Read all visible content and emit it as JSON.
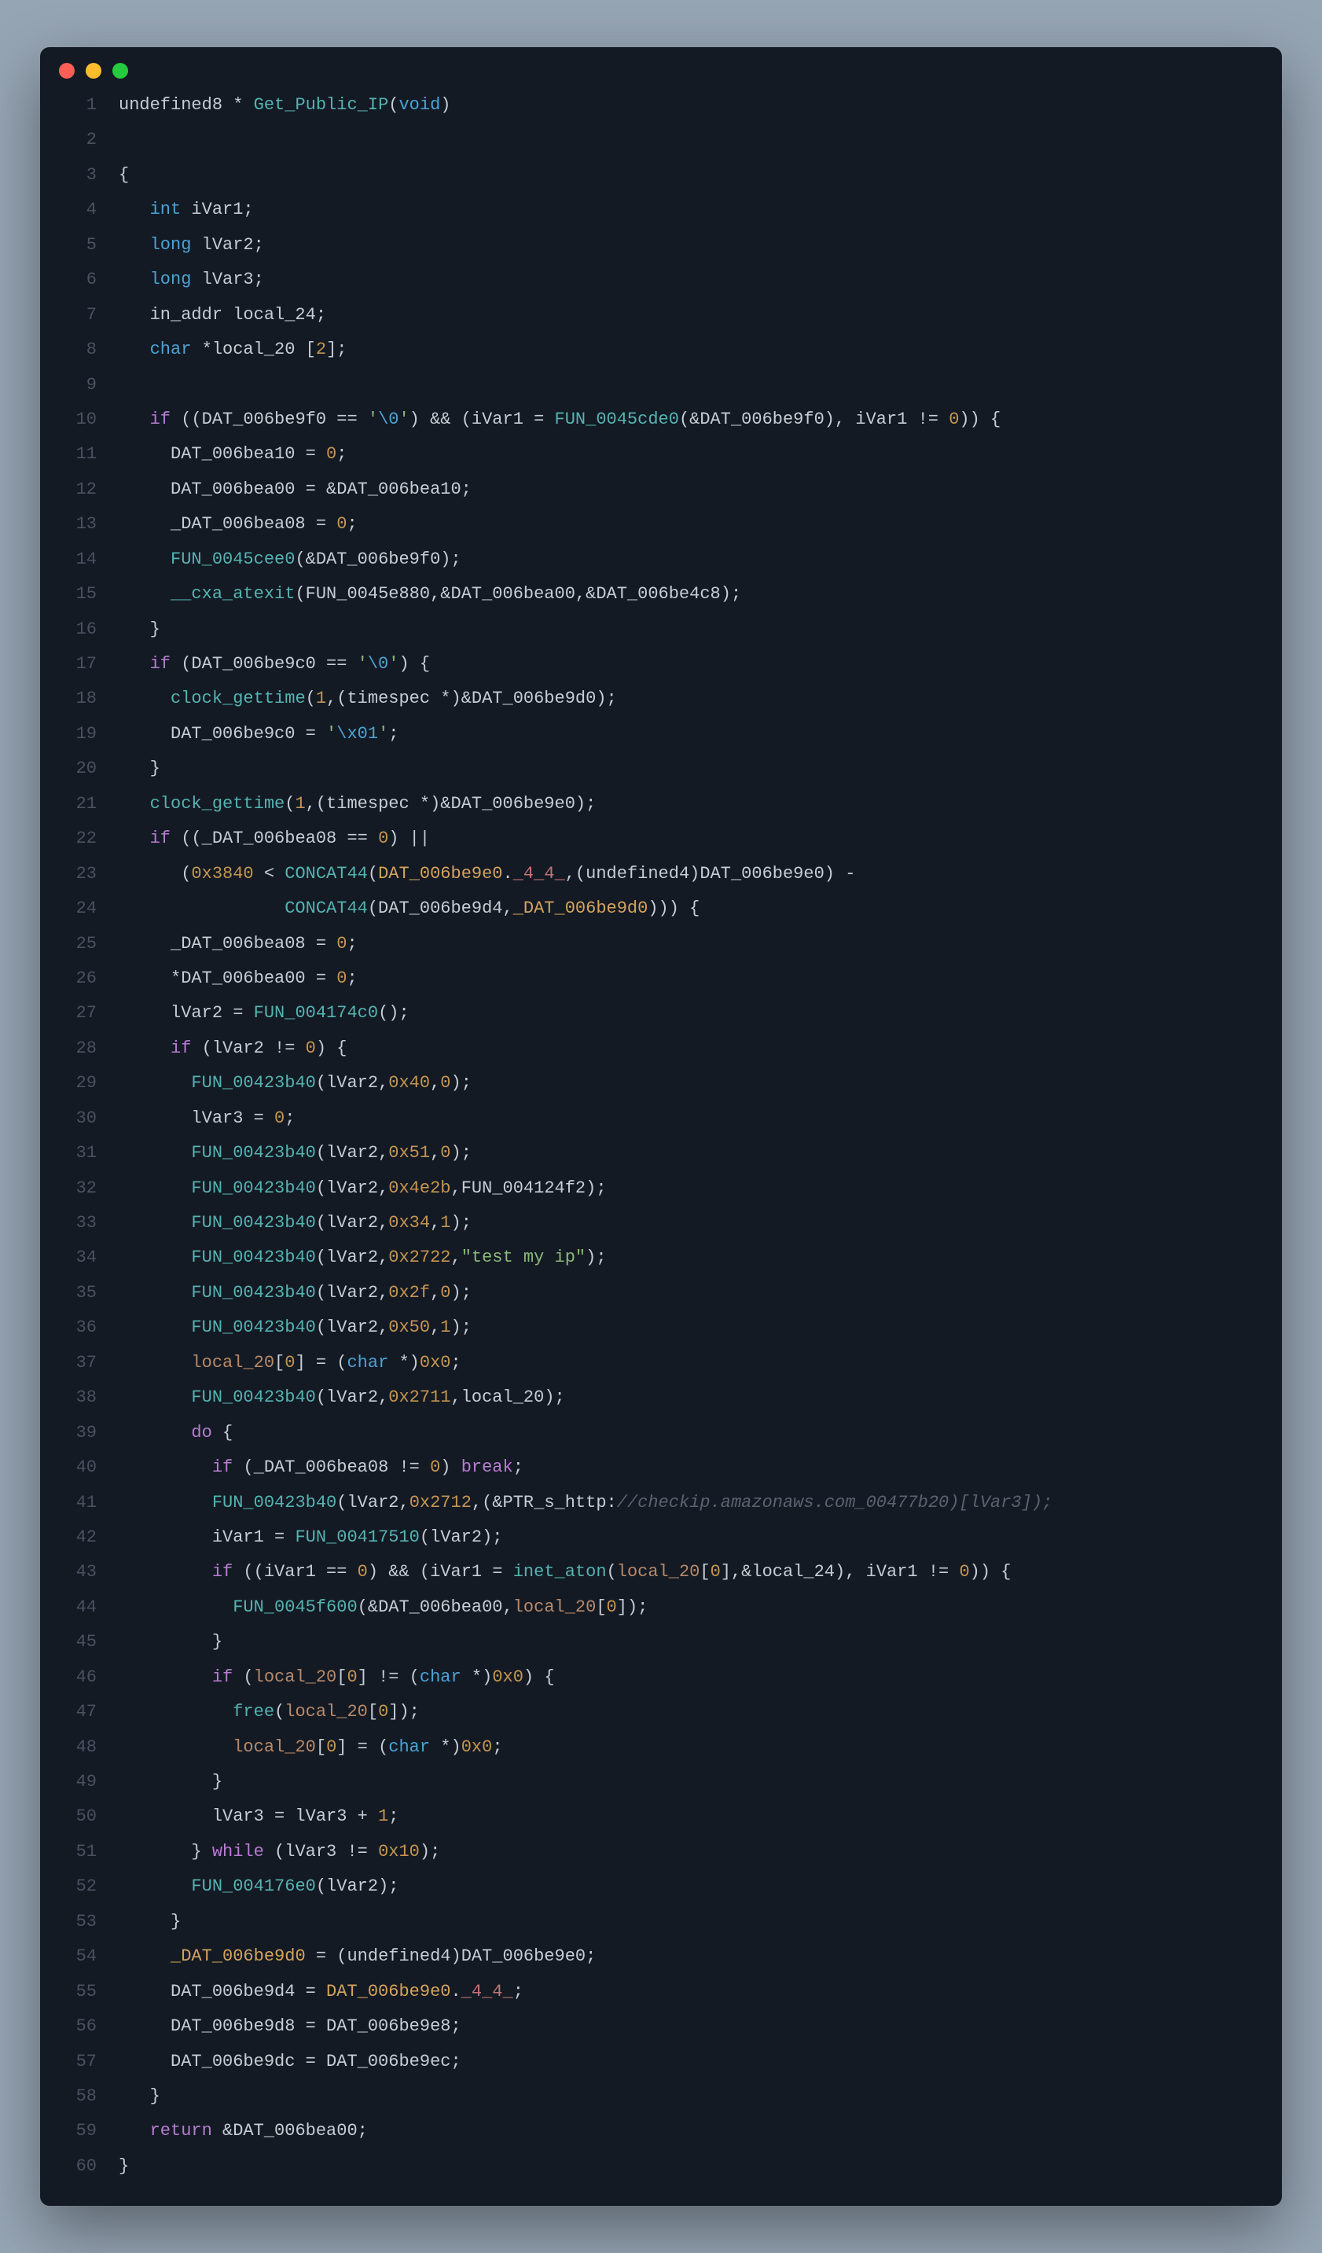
{
  "window": {
    "traffic_lights": [
      "red",
      "yellow",
      "green"
    ]
  },
  "code_lines": [
    {
      "n": 1,
      "tokens": [
        [
          "plain",
          "undefined8 * "
        ],
        [
          "fn",
          "Get_Public_IP"
        ],
        [
          "plain",
          "("
        ],
        [
          "type",
          "void"
        ],
        [
          "plain",
          ")"
        ]
      ]
    },
    {
      "n": 2,
      "tokens": []
    },
    {
      "n": 3,
      "tokens": [
        [
          "plain",
          "{"
        ]
      ]
    },
    {
      "n": 4,
      "tokens": [
        [
          "plain",
          "   "
        ],
        [
          "type",
          "int"
        ],
        [
          "plain",
          " iVar1;"
        ]
      ]
    },
    {
      "n": 5,
      "tokens": [
        [
          "plain",
          "   "
        ],
        [
          "type",
          "long"
        ],
        [
          "plain",
          " lVar2;"
        ]
      ]
    },
    {
      "n": 6,
      "tokens": [
        [
          "plain",
          "   "
        ],
        [
          "type",
          "long"
        ],
        [
          "plain",
          " lVar3;"
        ]
      ]
    },
    {
      "n": 7,
      "tokens": [
        [
          "plain",
          "   in_addr local_24;"
        ]
      ]
    },
    {
      "n": 8,
      "tokens": [
        [
          "plain",
          "   "
        ],
        [
          "type",
          "char"
        ],
        [
          "plain",
          " *local_20 ["
        ],
        [
          "num",
          "2"
        ],
        [
          "plain",
          "];"
        ]
      ]
    },
    {
      "n": 9,
      "tokens": []
    },
    {
      "n": 10,
      "tokens": [
        [
          "plain",
          "   "
        ],
        [
          "kw",
          "if"
        ],
        [
          "plain",
          " ((DAT_006be9f0 == "
        ],
        [
          "str",
          "'"
        ],
        [
          "esc",
          "\\0"
        ],
        [
          "str",
          "'"
        ],
        [
          "plain",
          ") && (iVar1 = "
        ],
        [
          "fn",
          "FUN_0045cde0"
        ],
        [
          "plain",
          "(&DAT_006be9f0), iVar1 != "
        ],
        [
          "num",
          "0"
        ],
        [
          "plain",
          ")) {"
        ]
      ]
    },
    {
      "n": 11,
      "tokens": [
        [
          "plain",
          "     DAT_006bea10 = "
        ],
        [
          "num",
          "0"
        ],
        [
          "plain",
          ";"
        ]
      ]
    },
    {
      "n": 12,
      "tokens": [
        [
          "plain",
          "     DAT_006bea00 = &DAT_006bea10;"
        ]
      ]
    },
    {
      "n": 13,
      "tokens": [
        [
          "plain",
          "     _DAT_006bea08 = "
        ],
        [
          "num",
          "0"
        ],
        [
          "plain",
          ";"
        ]
      ]
    },
    {
      "n": 14,
      "tokens": [
        [
          "plain",
          "     "
        ],
        [
          "fn",
          "FUN_0045cee0"
        ],
        [
          "plain",
          "(&DAT_006be9f0);"
        ]
      ]
    },
    {
      "n": 15,
      "tokens": [
        [
          "plain",
          "     "
        ],
        [
          "fn",
          "__cxa_atexit"
        ],
        [
          "plain",
          "(FUN_0045e880,&DAT_006bea00,&DAT_006be4c8);"
        ]
      ]
    },
    {
      "n": 16,
      "tokens": [
        [
          "plain",
          "   }"
        ]
      ]
    },
    {
      "n": 17,
      "tokens": [
        [
          "plain",
          "   "
        ],
        [
          "kw",
          "if"
        ],
        [
          "plain",
          " (DAT_006be9c0 == "
        ],
        [
          "str",
          "'"
        ],
        [
          "esc",
          "\\0"
        ],
        [
          "str",
          "'"
        ],
        [
          "plain",
          ") {"
        ]
      ]
    },
    {
      "n": 18,
      "tokens": [
        [
          "plain",
          "     "
        ],
        [
          "fn",
          "clock_gettime"
        ],
        [
          "plain",
          "("
        ],
        [
          "num",
          "1"
        ],
        [
          "plain",
          ",(timespec *)&DAT_006be9d0);"
        ]
      ]
    },
    {
      "n": 19,
      "tokens": [
        [
          "plain",
          "     DAT_006be9c0 = "
        ],
        [
          "str",
          "'"
        ],
        [
          "esc",
          "\\x01"
        ],
        [
          "str",
          "'"
        ],
        [
          "plain",
          ";"
        ]
      ]
    },
    {
      "n": 20,
      "tokens": [
        [
          "plain",
          "   }"
        ]
      ]
    },
    {
      "n": 21,
      "tokens": [
        [
          "plain",
          "   "
        ],
        [
          "fn",
          "clock_gettime"
        ],
        [
          "plain",
          "("
        ],
        [
          "num",
          "1"
        ],
        [
          "plain",
          ",(timespec *)&DAT_006be9e0);"
        ]
      ]
    },
    {
      "n": 22,
      "tokens": [
        [
          "plain",
          "   "
        ],
        [
          "kw",
          "if"
        ],
        [
          "plain",
          " ((_DAT_006bea08 == "
        ],
        [
          "num",
          "0"
        ],
        [
          "plain",
          ") ||"
        ]
      ]
    },
    {
      "n": 23,
      "tokens": [
        [
          "plain",
          "      ("
        ],
        [
          "num",
          "0x3840"
        ],
        [
          "plain",
          " < "
        ],
        [
          "fn",
          "CONCAT44"
        ],
        [
          "plain",
          "("
        ],
        [
          "id",
          "DAT_006be9e0"
        ],
        [
          "plain",
          "."
        ],
        [
          "member",
          "_4_4_"
        ],
        [
          "plain",
          ",(undefined4)DAT_006be9e0) -"
        ]
      ]
    },
    {
      "n": 24,
      "tokens": [
        [
          "plain",
          "                "
        ],
        [
          "fn",
          "CONCAT44"
        ],
        [
          "plain",
          "(DAT_006be9d4,"
        ],
        [
          "id",
          "_DAT_006be9d0"
        ],
        [
          "plain",
          "))) {"
        ]
      ]
    },
    {
      "n": 25,
      "tokens": [
        [
          "plain",
          "     _DAT_006bea08 = "
        ],
        [
          "num",
          "0"
        ],
        [
          "plain",
          ";"
        ]
      ]
    },
    {
      "n": 26,
      "tokens": [
        [
          "plain",
          "     *DAT_006bea00 = "
        ],
        [
          "num",
          "0"
        ],
        [
          "plain",
          ";"
        ]
      ]
    },
    {
      "n": 27,
      "tokens": [
        [
          "plain",
          "     lVar2 = "
        ],
        [
          "fn",
          "FUN_004174c0"
        ],
        [
          "plain",
          "();"
        ]
      ]
    },
    {
      "n": 28,
      "tokens": [
        [
          "plain",
          "     "
        ],
        [
          "kw",
          "if"
        ],
        [
          "plain",
          " (lVar2 != "
        ],
        [
          "num",
          "0"
        ],
        [
          "plain",
          ") {"
        ]
      ]
    },
    {
      "n": 29,
      "tokens": [
        [
          "plain",
          "       "
        ],
        [
          "fn",
          "FUN_00423b40"
        ],
        [
          "plain",
          "(lVar2,"
        ],
        [
          "num",
          "0x40"
        ],
        [
          "plain",
          ","
        ],
        [
          "num",
          "0"
        ],
        [
          "plain",
          ");"
        ]
      ]
    },
    {
      "n": 30,
      "tokens": [
        [
          "plain",
          "       lVar3 = "
        ],
        [
          "num",
          "0"
        ],
        [
          "plain",
          ";"
        ]
      ]
    },
    {
      "n": 31,
      "tokens": [
        [
          "plain",
          "       "
        ],
        [
          "fn",
          "FUN_00423b40"
        ],
        [
          "plain",
          "(lVar2,"
        ],
        [
          "num",
          "0x51"
        ],
        [
          "plain",
          ","
        ],
        [
          "num",
          "0"
        ],
        [
          "plain",
          ");"
        ]
      ]
    },
    {
      "n": 32,
      "tokens": [
        [
          "plain",
          "       "
        ],
        [
          "fn",
          "FUN_00423b40"
        ],
        [
          "plain",
          "(lVar2,"
        ],
        [
          "num",
          "0x4e2b"
        ],
        [
          "plain",
          ",FUN_004124f2);"
        ]
      ]
    },
    {
      "n": 33,
      "tokens": [
        [
          "plain",
          "       "
        ],
        [
          "fn",
          "FUN_00423b40"
        ],
        [
          "plain",
          "(lVar2,"
        ],
        [
          "num",
          "0x34"
        ],
        [
          "plain",
          ","
        ],
        [
          "num",
          "1"
        ],
        [
          "plain",
          ");"
        ]
      ]
    },
    {
      "n": 34,
      "tokens": [
        [
          "plain",
          "       "
        ],
        [
          "fn",
          "FUN_00423b40"
        ],
        [
          "plain",
          "(lVar2,"
        ],
        [
          "num",
          "0x2722"
        ],
        [
          "plain",
          ","
        ],
        [
          "str",
          "\"test my ip\""
        ],
        [
          "plain",
          ");"
        ]
      ]
    },
    {
      "n": 35,
      "tokens": [
        [
          "plain",
          "       "
        ],
        [
          "fn",
          "FUN_00423b40"
        ],
        [
          "plain",
          "(lVar2,"
        ],
        [
          "num",
          "0x2f"
        ],
        [
          "plain",
          ","
        ],
        [
          "num",
          "0"
        ],
        [
          "plain",
          ");"
        ]
      ]
    },
    {
      "n": 36,
      "tokens": [
        [
          "plain",
          "       "
        ],
        [
          "fn",
          "FUN_00423b40"
        ],
        [
          "plain",
          "(lVar2,"
        ],
        [
          "num",
          "0x50"
        ],
        [
          "plain",
          ","
        ],
        [
          "num",
          "1"
        ],
        [
          "plain",
          ");"
        ]
      ]
    },
    {
      "n": 37,
      "tokens": [
        [
          "plain",
          "       "
        ],
        [
          "var",
          "local_20"
        ],
        [
          "plain",
          "["
        ],
        [
          "num",
          "0"
        ],
        [
          "plain",
          "] = ("
        ],
        [
          "type",
          "char"
        ],
        [
          "plain",
          " *)"
        ],
        [
          "num",
          "0x0"
        ],
        [
          "plain",
          ";"
        ]
      ]
    },
    {
      "n": 38,
      "tokens": [
        [
          "plain",
          "       "
        ],
        [
          "fn",
          "FUN_00423b40"
        ],
        [
          "plain",
          "(lVar2,"
        ],
        [
          "num",
          "0x2711"
        ],
        [
          "plain",
          ",local_20);"
        ]
      ]
    },
    {
      "n": 39,
      "tokens": [
        [
          "plain",
          "       "
        ],
        [
          "kw",
          "do"
        ],
        [
          "plain",
          " {"
        ]
      ]
    },
    {
      "n": 40,
      "tokens": [
        [
          "plain",
          "         "
        ],
        [
          "kw",
          "if"
        ],
        [
          "plain",
          " (_DAT_006bea08 != "
        ],
        [
          "num",
          "0"
        ],
        [
          "plain",
          ") "
        ],
        [
          "kw",
          "break"
        ],
        [
          "plain",
          ";"
        ]
      ]
    },
    {
      "n": 41,
      "tokens": [
        [
          "plain",
          "         "
        ],
        [
          "fn",
          "FUN_00423b40"
        ],
        [
          "plain",
          "(lVar2,"
        ],
        [
          "num",
          "0x2712"
        ],
        [
          "plain",
          ",(&PTR_s_http:"
        ],
        [
          "comment",
          "//checkip.amazonaws.com_00477b20)[lVar3]);"
        ]
      ]
    },
    {
      "n": 42,
      "tokens": [
        [
          "plain",
          "         iVar1 = "
        ],
        [
          "fn",
          "FUN_00417510"
        ],
        [
          "plain",
          "(lVar2);"
        ]
      ]
    },
    {
      "n": 43,
      "tokens": [
        [
          "plain",
          "         "
        ],
        [
          "kw",
          "if"
        ],
        [
          "plain",
          " ((iVar1 == "
        ],
        [
          "num",
          "0"
        ],
        [
          "plain",
          ") && (iVar1 = "
        ],
        [
          "fn",
          "inet_aton"
        ],
        [
          "plain",
          "("
        ],
        [
          "var",
          "local_20"
        ],
        [
          "plain",
          "["
        ],
        [
          "num",
          "0"
        ],
        [
          "plain",
          "],&local_24), iVar1 != "
        ],
        [
          "num",
          "0"
        ],
        [
          "plain",
          ")) {"
        ]
      ]
    },
    {
      "n": 44,
      "tokens": [
        [
          "plain",
          "           "
        ],
        [
          "fn",
          "FUN_0045f600"
        ],
        [
          "plain",
          "(&DAT_006bea00,"
        ],
        [
          "var",
          "local_20"
        ],
        [
          "plain",
          "["
        ],
        [
          "num",
          "0"
        ],
        [
          "plain",
          "]);"
        ]
      ]
    },
    {
      "n": 45,
      "tokens": [
        [
          "plain",
          "         }"
        ]
      ]
    },
    {
      "n": 46,
      "tokens": [
        [
          "plain",
          "         "
        ],
        [
          "kw",
          "if"
        ],
        [
          "plain",
          " ("
        ],
        [
          "var",
          "local_20"
        ],
        [
          "plain",
          "["
        ],
        [
          "num",
          "0"
        ],
        [
          "plain",
          "] != ("
        ],
        [
          "type",
          "char"
        ],
        [
          "plain",
          " *)"
        ],
        [
          "num",
          "0x0"
        ],
        [
          "plain",
          ") {"
        ]
      ]
    },
    {
      "n": 47,
      "tokens": [
        [
          "plain",
          "           "
        ],
        [
          "fn",
          "free"
        ],
        [
          "plain",
          "("
        ],
        [
          "var",
          "local_20"
        ],
        [
          "plain",
          "["
        ],
        [
          "num",
          "0"
        ],
        [
          "plain",
          "]);"
        ]
      ]
    },
    {
      "n": 48,
      "tokens": [
        [
          "plain",
          "           "
        ],
        [
          "var",
          "local_20"
        ],
        [
          "plain",
          "["
        ],
        [
          "num",
          "0"
        ],
        [
          "plain",
          "] = ("
        ],
        [
          "type",
          "char"
        ],
        [
          "plain",
          " *)"
        ],
        [
          "num",
          "0x0"
        ],
        [
          "plain",
          ";"
        ]
      ]
    },
    {
      "n": 49,
      "tokens": [
        [
          "plain",
          "         }"
        ]
      ]
    },
    {
      "n": 50,
      "tokens": [
        [
          "plain",
          "         lVar3 = lVar3 + "
        ],
        [
          "num",
          "1"
        ],
        [
          "plain",
          ";"
        ]
      ]
    },
    {
      "n": 51,
      "tokens": [
        [
          "plain",
          "       } "
        ],
        [
          "kw",
          "while"
        ],
        [
          "plain",
          " (lVar3 != "
        ],
        [
          "num",
          "0x10"
        ],
        [
          "plain",
          ");"
        ]
      ]
    },
    {
      "n": 52,
      "tokens": [
        [
          "plain",
          "       "
        ],
        [
          "fn",
          "FUN_004176e0"
        ],
        [
          "plain",
          "(lVar2);"
        ]
      ]
    },
    {
      "n": 53,
      "tokens": [
        [
          "plain",
          "     }"
        ]
      ]
    },
    {
      "n": 54,
      "tokens": [
        [
          "plain",
          "     "
        ],
        [
          "id",
          "_DAT_006be9d0"
        ],
        [
          "plain",
          " = (undefined4)DAT_006be9e0;"
        ]
      ]
    },
    {
      "n": 55,
      "tokens": [
        [
          "plain",
          "     DAT_006be9d4 = "
        ],
        [
          "id",
          "DAT_006be9e0"
        ],
        [
          "plain",
          "."
        ],
        [
          "member",
          "_4_4_"
        ],
        [
          "plain",
          ";"
        ]
      ]
    },
    {
      "n": 56,
      "tokens": [
        [
          "plain",
          "     DAT_006be9d8 = DAT_006be9e8;"
        ]
      ]
    },
    {
      "n": 57,
      "tokens": [
        [
          "plain",
          "     DAT_006be9dc = DAT_006be9ec;"
        ]
      ]
    },
    {
      "n": 58,
      "tokens": [
        [
          "plain",
          "   }"
        ]
      ]
    },
    {
      "n": 59,
      "tokens": [
        [
          "plain",
          "   "
        ],
        [
          "kw",
          "return"
        ],
        [
          "plain",
          " &DAT_006bea00;"
        ]
      ]
    },
    {
      "n": 60,
      "tokens": [
        [
          "plain",
          "}"
        ]
      ]
    }
  ]
}
